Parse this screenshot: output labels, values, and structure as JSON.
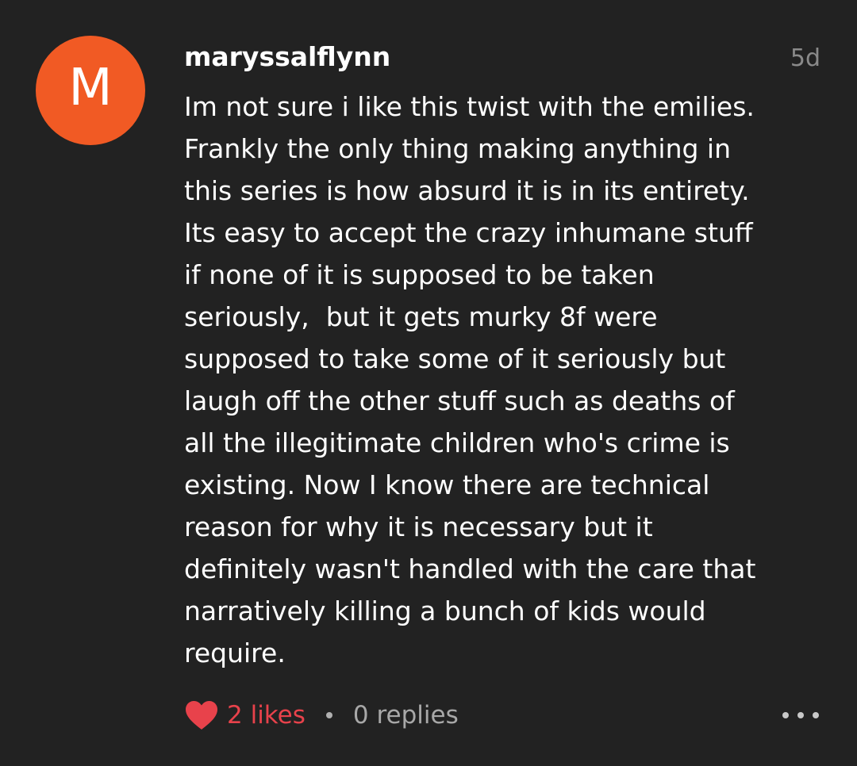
{
  "comment": {
    "avatar_letter": "M",
    "username": "maryssalflynn",
    "timestamp": "5d",
    "body_lines": [
      "Im not sure i like this twist with the emilies.",
      "Frankly the only thing making anything in",
      "this series is how absurd it is in its entirety.",
      "Its easy to accept the crazy inhumane stuff",
      "if none of it is supposed to be taken",
      "seriously,  but it gets murky 8f were",
      "supposed to take some of it seriously but",
      "laugh off the other stuff such as deaths of",
      "all the illegitimate children who's crime is",
      "existing. Now I know there are technical",
      "reason for why it is necessary but it",
      "definitely wasn't handled with the care that",
      "narratively killing a bunch of kids would",
      "require."
    ],
    "likes_label": "2 likes",
    "replies_label": "0 replies"
  },
  "icons": {
    "heart": "heart-icon",
    "more": "more-options-icon"
  },
  "colors": {
    "background": "#222222",
    "avatar": "#f15a24",
    "likes": "#e8424b",
    "muted": "#8a8a8a"
  }
}
